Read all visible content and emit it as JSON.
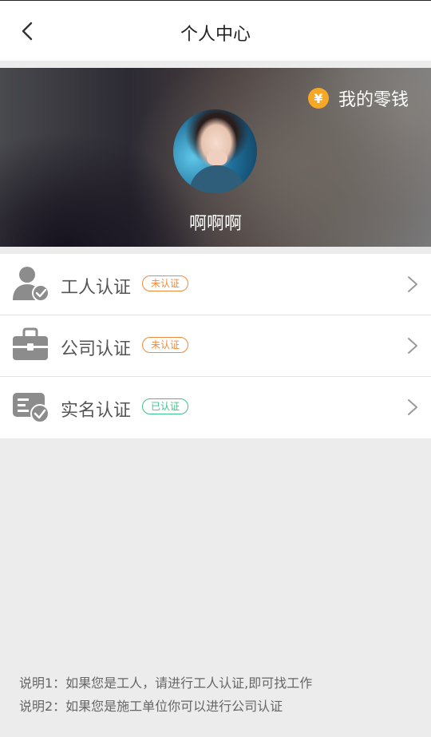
{
  "header": {
    "title": "个人中心"
  },
  "banner": {
    "wallet_label": "我的零钱",
    "wallet_icon_glyph": "¥",
    "user_name": "啊啊啊"
  },
  "colors": {
    "badge_pending": "#f08a3c",
    "badge_done": "#3cc48a",
    "wallet_icon": "#f5a825"
  },
  "list": {
    "items": [
      {
        "label": "工人认证",
        "icon": "worker-verify-icon",
        "status": "未认证",
        "status_type": "pending"
      },
      {
        "label": "公司认证",
        "icon": "briefcase-icon",
        "status": "未认证",
        "status_type": "pending"
      },
      {
        "label": "实名认证",
        "icon": "id-card-check-icon",
        "status": "已认证",
        "status_type": "done"
      }
    ]
  },
  "notes": [
    "说明1：如果您是工人，请进行工人认证,即可找工作",
    "说明2：如果您是施工单位你可以进行公司认证"
  ]
}
